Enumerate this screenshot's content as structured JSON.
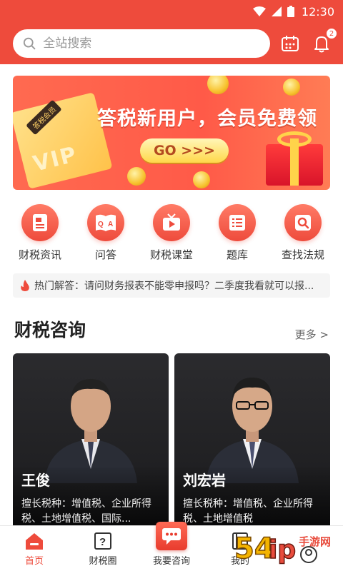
{
  "status_bar": {
    "time": "12:30"
  },
  "header": {
    "search_placeholder": "全站搜索",
    "notification_count": "2",
    "calendar_icon": "calendar-icon",
    "bell_icon": "bell-icon"
  },
  "banner": {
    "card_tag": "答税会员",
    "card_vip": "VIP",
    "title": "答税新用户，会员免费领",
    "go_label": "GO >>>"
  },
  "quick_nav": [
    {
      "label": "财税资讯",
      "icon": "news-icon"
    },
    {
      "label": "问答",
      "icon": "qa-book-icon"
    },
    {
      "label": "财税课堂",
      "icon": "tv-play-icon"
    },
    {
      "label": "题库",
      "icon": "list-icon"
    },
    {
      "label": "查找法规",
      "icon": "search-doc-icon"
    }
  ],
  "hot": {
    "text": "热门解答：请问财务报表不能零申报吗？二季度我看就可以报..."
  },
  "consult": {
    "title": "财税咨询",
    "more_label": "更多 >",
    "experts": [
      {
        "name": "王俊",
        "desc": "擅长税种：增值税、企业所得税、土地增值税、国际..."
      },
      {
        "name": "刘宏岩",
        "desc": "擅长税种：增值税、企业所得税、土地增值税"
      }
    ]
  },
  "tab_bar": [
    {
      "label": "首页",
      "icon": "home-icon",
      "active": true
    },
    {
      "label": "财税圈",
      "icon": "question-box-icon",
      "active": false
    },
    {
      "label": "我要咨询",
      "icon": "chat-bubble-icon",
      "active": false
    },
    {
      "label": "我的",
      "icon": "book-icon",
      "active": false
    },
    {
      "label": "",
      "icon": "profile-icon",
      "active": false
    }
  ],
  "watermark": {
    "text": "54ip手游网"
  },
  "colors": {
    "brand": "#ee4b3c",
    "banner": "#ff5a48",
    "gold": "#ffd34a"
  }
}
